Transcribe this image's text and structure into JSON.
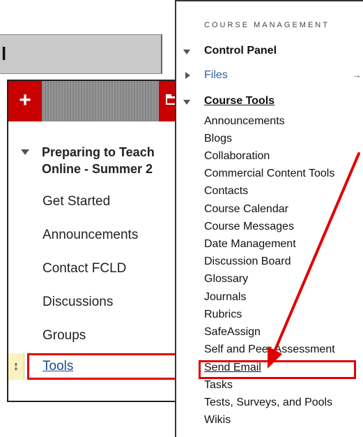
{
  "topbar": {
    "letter": "l"
  },
  "course_menu": {
    "add_symbol": "+",
    "icons": {
      "add": "plus-icon",
      "folder": "folder-icon",
      "expand": "triangle-down-icon",
      "reorder": "updown-arrow-icon"
    },
    "course_title": "Preparing to Teach\nOnline - Summer 2",
    "items": [
      "Get Started",
      "Announcements",
      "Contact FCLD",
      "Discussions",
      "Groups"
    ],
    "tools_label": "Tools",
    "handle_symbol": "↕"
  },
  "control_panel": {
    "section_label": "COURSE MANAGEMENT",
    "control_panel_label": "Control Panel",
    "files_label": "Files",
    "files_arrow": "→",
    "course_tools_label": "Course Tools",
    "tools": [
      "Announcements",
      "Blogs",
      "Collaboration",
      "Commercial Content Tools",
      "Contacts",
      "Course Calendar",
      "Course Messages",
      "Date Management",
      "Discussion Board",
      "Glossary",
      "Journals",
      "Rubrics",
      "SafeAssign",
      "Self and Peer Assessment",
      "Send Email",
      "Tasks",
      "Tests, Surveys, and Pools",
      "Wikis"
    ]
  },
  "colors": {
    "accent_red": "#c80000",
    "highlight_red": "#e10000",
    "link_blue": "#2f5f9f"
  }
}
